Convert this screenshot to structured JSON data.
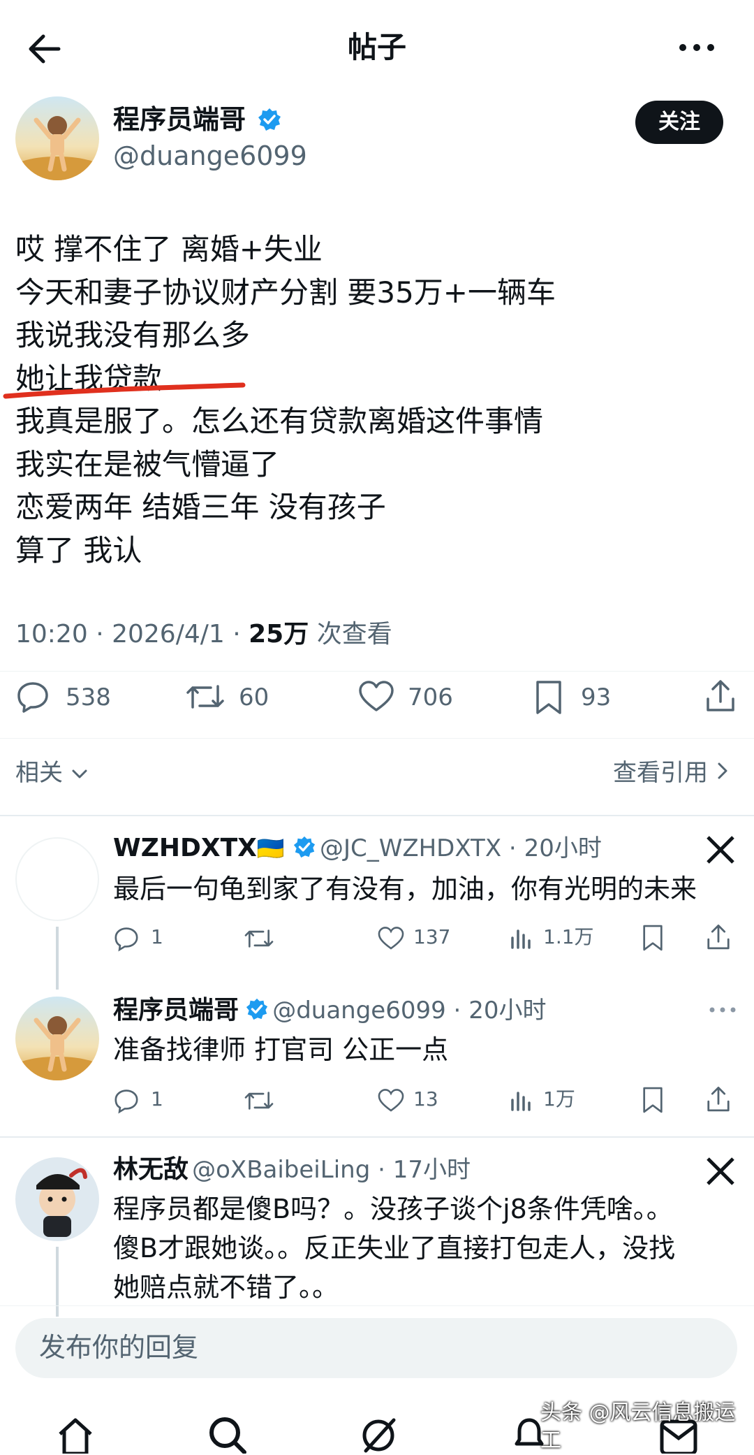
{
  "header": {
    "title": "帖子",
    "back_icon": "arrow-left-icon",
    "more_icon": "more-horizontal-icon"
  },
  "post": {
    "author_name": "程序员端哥",
    "author_handle": "@duange6099",
    "follow_label": "关注",
    "lines": [
      "哎 撑不住了 离婚+失业",
      "今天和妻子协议财产分割 要35万+一辆车",
      "我说我没有那么多",
      "她让我贷款",
      "我真是服了。怎么还有贷款离婚这件事情",
      "我实在是被气懵逼了",
      "恋爱两年 结婚三年 没有孩子",
      "算了 我认"
    ],
    "highlighted_line": "她让我贷款",
    "time": "10:20",
    "date": "2026/4/1",
    "views": "25万",
    "views_label": "次查看",
    "stats": {
      "replies": "538",
      "retweets": "60",
      "likes": "706",
      "bookmarks": "93"
    }
  },
  "related": {
    "label": "相关",
    "quotes_label": "查看引用"
  },
  "replies": [
    {
      "name": "WZHDXTX",
      "flag": "🇺🇦",
      "handle": "@JC_WZHDXTX",
      "time": "20小时",
      "text": [
        "最后一句龟到家了有没有，加油，你有光明的未来"
      ],
      "stats": {
        "replies": "1",
        "likes": "137",
        "views": "1.1万"
      }
    },
    {
      "name": "程序员端哥",
      "handle": "@duange6099",
      "time": "20小时",
      "text": [
        "准备找律师 打官司 公正一点"
      ],
      "stats": {
        "replies": "1",
        "likes": "13",
        "views": "1万"
      }
    },
    {
      "name": "林无敌",
      "handle": "@oXBaibeiLing",
      "time": "17小时",
      "text": [
        "程序员都是傻B吗？。没孩子谈个j8条件凭啥。。",
        "傻B才跟她谈。。反正失业了直接打包走人，没找",
        "她赔点就不错了。。"
      ]
    }
  ],
  "composer": {
    "placeholder": "发布你的回复"
  },
  "watermark": "头条 @风云信息搬运工",
  "colors": {
    "accent": "#1d9bf0",
    "highlight": "#e0301e",
    "text": "#0f1419",
    "muted": "#536471"
  }
}
